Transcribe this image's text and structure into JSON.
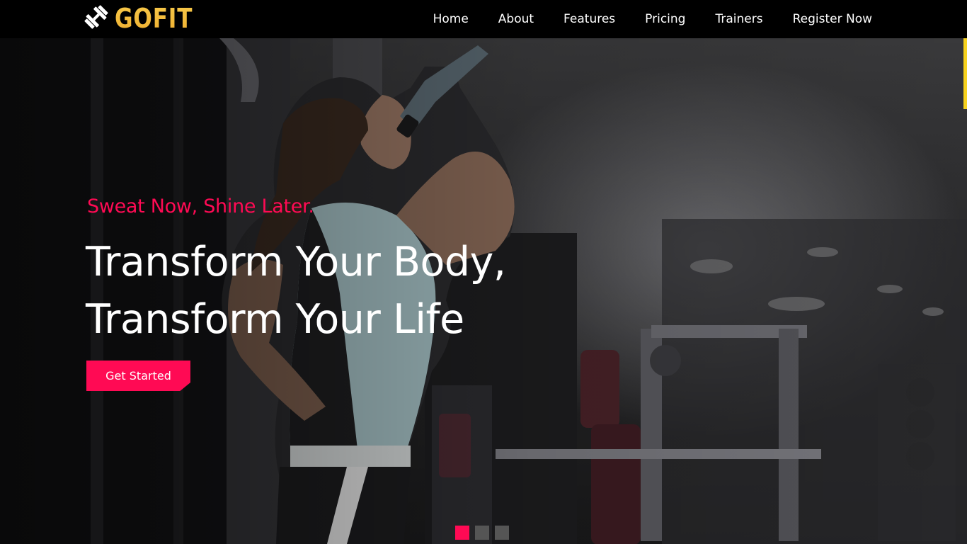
{
  "brand": {
    "name": "GOFIT",
    "icon": "dumbbell-icon"
  },
  "nav": {
    "items": [
      {
        "label": "Home"
      },
      {
        "label": "About"
      },
      {
        "label": "Features"
      },
      {
        "label": "Pricing"
      },
      {
        "label": "Trainers"
      },
      {
        "label": "Register Now"
      }
    ]
  },
  "hero": {
    "tagline": "Sweat Now, Shine Later.",
    "headline_line1": "Transform Your Body,",
    "headline_line2": "Transform Your Life",
    "cta_label": "Get Started",
    "slide_count": 3,
    "active_slide": 1
  },
  "colors": {
    "accent": "#ff0a54",
    "brand_gold": "#f7c94a",
    "nav_bg": "#000000",
    "scroll_accent": "#f7d21e"
  }
}
